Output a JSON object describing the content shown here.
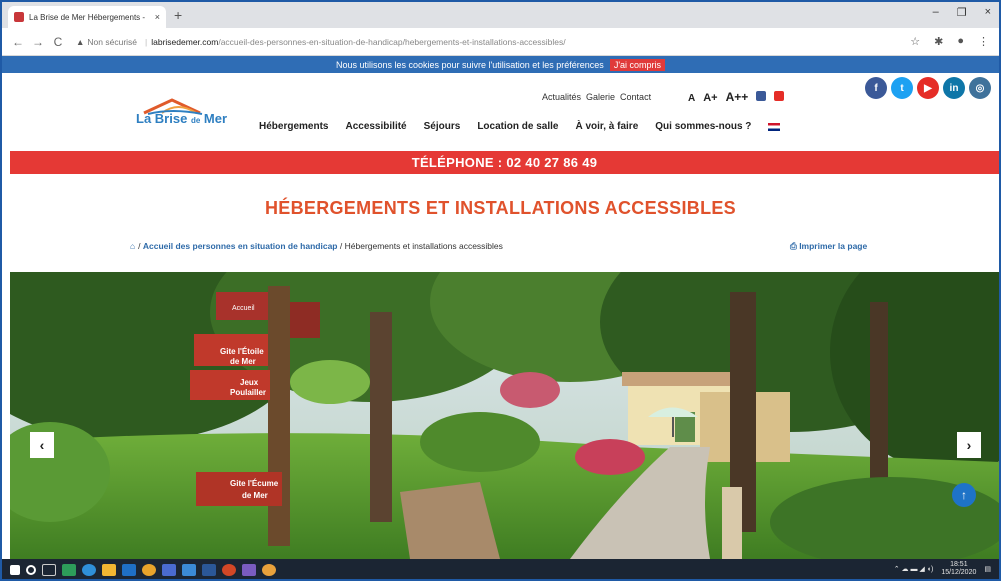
{
  "browser": {
    "tab_title": "La Brise de Mer Hébergements -",
    "tab_close": "×",
    "new_tab": "+",
    "url_warning": "▲",
    "url_security": "Non sécurisé",
    "url_domain": "labrisedemer.com",
    "url_path": "/accueil-des-personnes-en-situation-de-handicap/hebergements-et-installations-accessibles/",
    "back": "←",
    "forward": "→",
    "reload": "C",
    "win_min": "–",
    "win_max": "❐",
    "win_close": "×"
  },
  "cookie_bar": {
    "message": "Nous utilisons les cookies pour suivre l'utilisation et les préférences",
    "button": "J'ai compris"
  },
  "header": {
    "logo_word1": "La Brise",
    "logo_word2": "de",
    "logo_word3": "Mer",
    "util_links": [
      "Actualités",
      "Galerie",
      "Contact"
    ],
    "font_sizes": [
      "A",
      "A+",
      "A++"
    ],
    "nav": [
      "Hébergements",
      "Accessibilité",
      "Séjours",
      "Location de salle",
      "À voir, à faire",
      "Qui sommes-nous ?"
    ],
    "social": [
      {
        "label": "f",
        "color": "#3b5998",
        "icon": "facebook-icon"
      },
      {
        "label": "t",
        "color": "#1da1f2",
        "icon": "twitter-icon"
      },
      {
        "label": "▶",
        "color": "#e52d27",
        "icon": "youtube-icon"
      },
      {
        "label": "in",
        "color": "#0e76a8",
        "icon": "linkedin-icon"
      },
      {
        "label": "◎",
        "color": "#3f729b",
        "icon": "instagram-icon"
      }
    ]
  },
  "phone_bar": "TÉLÉPHONE : 02 40 27 86 49",
  "page": {
    "title": "HÉBERGEMENTS ET INSTALLATIONS ACCESSIBLES",
    "breadcrumb_home_icon": "⌂",
    "breadcrumb_link": "Accueil des personnes en situation de handicap",
    "breadcrumb_sep": "/",
    "breadcrumb_current": "Hébergements et installations accessibles",
    "print_label": "Imprimer la page"
  },
  "hero": {
    "signs": [
      "Accueil",
      "Gite l'Étoile de Mer",
      "Jeux Poulailler",
      "Gite l'Écume de Mer"
    ],
    "prev_label": "‹",
    "next_label": "›",
    "scroll_top_label": "↑"
  },
  "taskbar": {
    "time": "18:51",
    "date": "15/12/2020"
  }
}
